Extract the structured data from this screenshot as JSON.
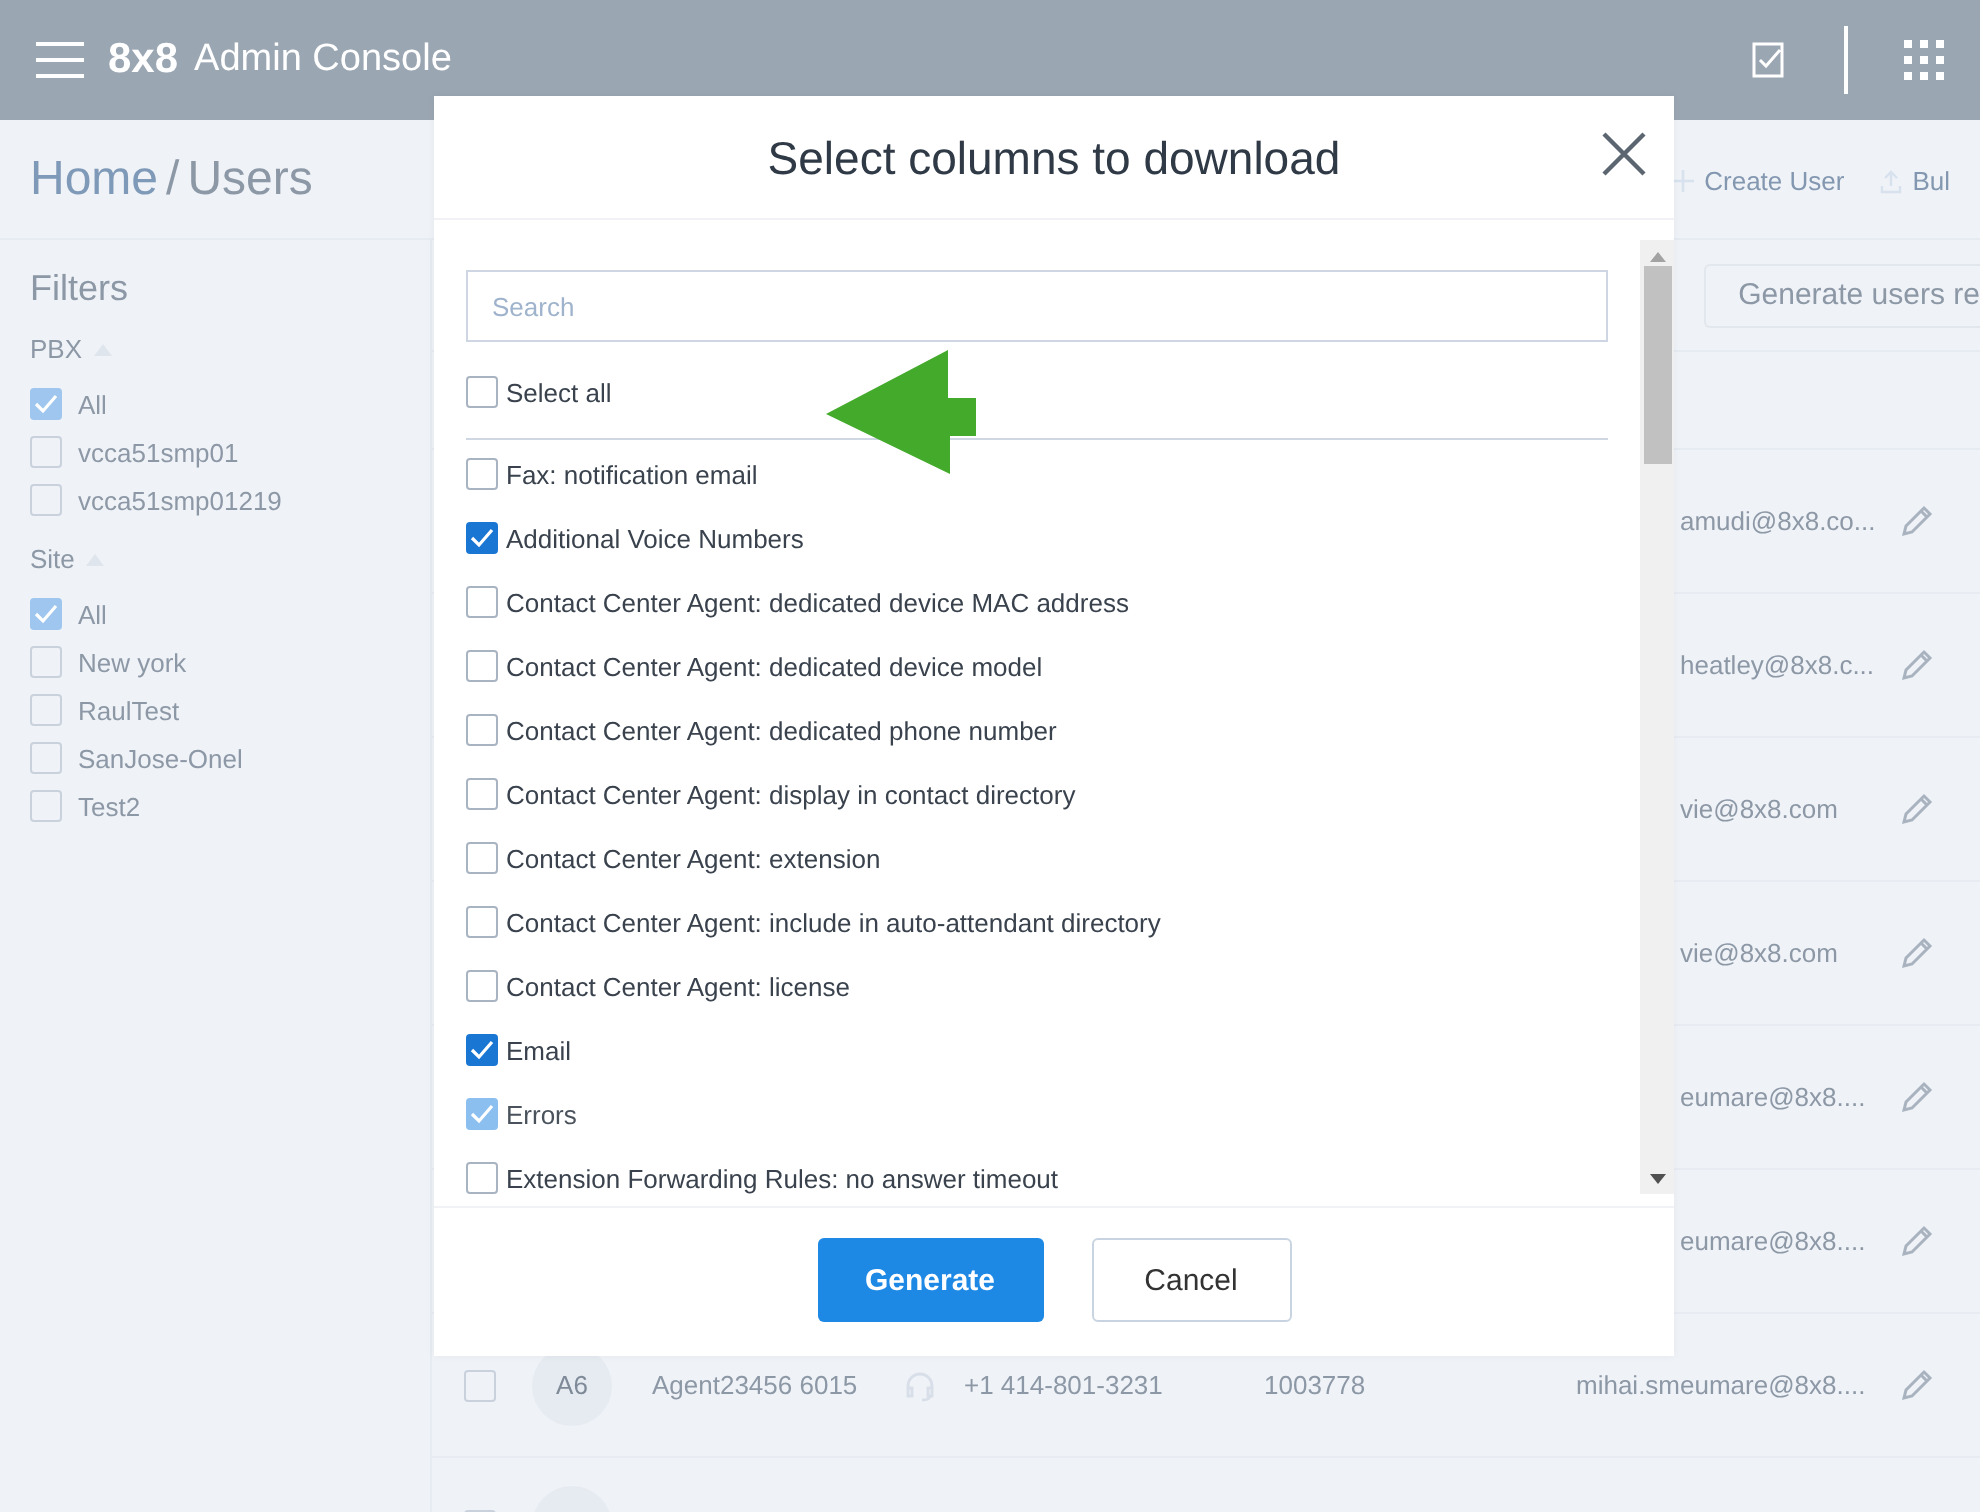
{
  "header": {
    "logo": "8x8",
    "title": "Admin Console"
  },
  "breadcrumb": {
    "home": "Home",
    "separator": "/",
    "current": "Users"
  },
  "actions": [
    {
      "label": "Create User",
      "kind": "plus"
    },
    {
      "label": "Bul",
      "kind": "upload"
    }
  ],
  "filters": {
    "title": "Filters",
    "groups": [
      {
        "label": "PBX",
        "expanded": true,
        "options": [
          {
            "label": "All",
            "checked": true
          },
          {
            "label": "vcca51smp01",
            "checked": false
          },
          {
            "label": "vcca51smp01219",
            "checked": false
          }
        ]
      },
      {
        "label": "Site",
        "expanded": true,
        "options": [
          {
            "label": "All",
            "checked": true
          },
          {
            "label": "New york",
            "checked": false
          },
          {
            "label": "RaulTest",
            "checked": false
          },
          {
            "label": "SanJose-Onel",
            "checked": false
          },
          {
            "label": "Test2",
            "checked": false
          }
        ]
      }
    ]
  },
  "report_button": "Generate users re",
  "rows": [
    {
      "kind": "covered",
      "email": "amudi@8x8.co..."
    },
    {
      "kind": "covered",
      "email": "heatley@8x8.c..."
    },
    {
      "kind": "covered",
      "email": "vie@8x8.com"
    },
    {
      "kind": "covered",
      "email": "vie@8x8.com"
    },
    {
      "kind": "covered",
      "email": "eumare@8x8...."
    },
    {
      "kind": "covered",
      "email": "eumare@8x8...."
    },
    {
      "kind": "full",
      "checked": false,
      "avatar": "A6",
      "name": "Agent23456 6015",
      "phone": "+1 414-801-3231",
      "extension": "1003778",
      "email": "mihai.smeumare@8x8...."
    },
    {
      "kind": "cut",
      "checked": false
    }
  ],
  "dialog": {
    "title": "Select columns to download",
    "search": {
      "placeholder": "Search"
    },
    "select_all": {
      "label": "Select all",
      "checked": false
    },
    "columns": [
      {
        "label": "Fax: notification email",
        "checked": false,
        "disabled": false
      },
      {
        "label": "Additional Voice Numbers",
        "checked": true,
        "disabled": false
      },
      {
        "label": "Contact Center Agent: dedicated device MAC address",
        "checked": false,
        "disabled": false
      },
      {
        "label": "Contact Center Agent: dedicated device model",
        "checked": false,
        "disabled": false
      },
      {
        "label": "Contact Center Agent: dedicated phone number",
        "checked": false,
        "disabled": false
      },
      {
        "label": "Contact Center Agent: display in contact directory",
        "checked": false,
        "disabled": false
      },
      {
        "label": "Contact Center Agent: extension",
        "checked": false,
        "disabled": false
      },
      {
        "label": "Contact Center Agent: include in auto-attendant directory",
        "checked": false,
        "disabled": false
      },
      {
        "label": "Contact Center Agent: license",
        "checked": false,
        "disabled": false
      },
      {
        "label": "Email",
        "checked": true,
        "disabled": false
      },
      {
        "label": "Errors",
        "checked": true,
        "disabled": true
      },
      {
        "label": "Extension Forwarding Rules: no answer timeout",
        "checked": false,
        "disabled": false
      }
    ],
    "buttons": [
      {
        "label": "Generate",
        "kind": "primary"
      },
      {
        "label": "Cancel",
        "kind": "secondary"
      }
    ]
  }
}
